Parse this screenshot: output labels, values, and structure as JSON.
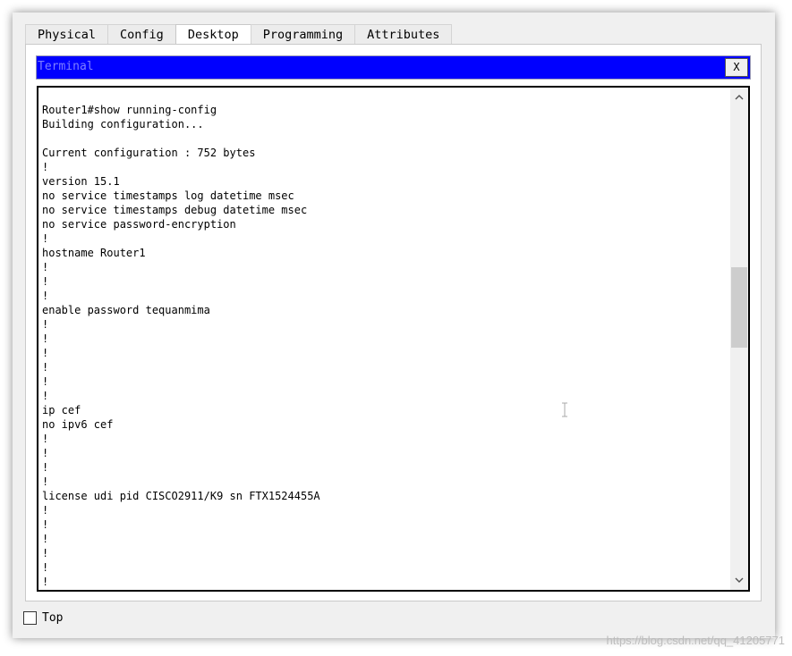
{
  "tabs": [
    {
      "label": "Physical",
      "active": false
    },
    {
      "label": "Config",
      "active": false
    },
    {
      "label": "Desktop",
      "active": true
    },
    {
      "label": "Programming",
      "active": false
    },
    {
      "label": "Attributes",
      "active": false
    }
  ],
  "terminal": {
    "title": "Terminal",
    "close_label": "X",
    "lines": [
      "Router1#show running-config",
      "Building configuration...",
      "",
      "Current configuration : 752 bytes",
      "!",
      "version 15.1",
      "no service timestamps log datetime msec",
      "no service timestamps debug datetime msec",
      "no service password-encryption",
      "!",
      "hostname Router1",
      "!",
      "!",
      "!",
      "enable password tequanmima",
      "!",
      "!",
      "!",
      "!",
      "!",
      "!",
      "ip cef",
      "no ipv6 cef",
      "!",
      "!",
      "!",
      "!",
      "license udi pid CISCO2911/K9 sn FTX1524455A",
      "!",
      "!",
      "!",
      "!",
      "!",
      "!"
    ],
    "scroll_position": 0.42
  },
  "bottom": {
    "top_checkbox_label": "Top",
    "top_checked": false
  },
  "watermark": "https://blog.csdn.net/qq_41205771",
  "colors": {
    "titlebar_bg": "#0000ff",
    "titlebar_text": "#7f7fff",
    "window_bg": "#f0f0f0"
  },
  "icons": {
    "scroll_up": "chevron-up-icon",
    "scroll_down": "chevron-down-icon",
    "cursor": "text-cursor-icon"
  }
}
